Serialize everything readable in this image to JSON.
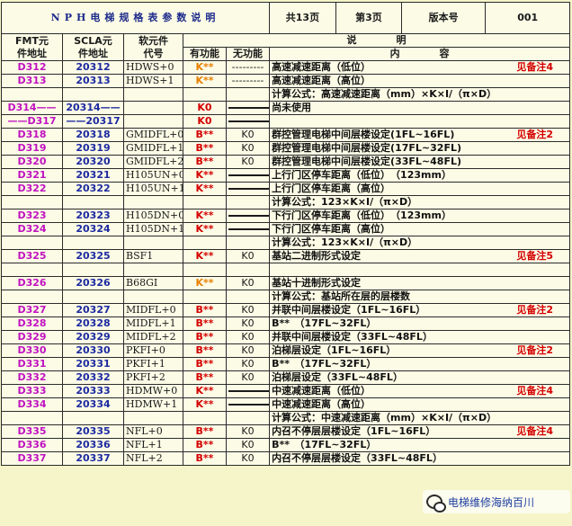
{
  "title": "NPH电梯规格表参数说明",
  "pager": {
    "total": "共13页",
    "page": "第3页",
    "version_label": "版本号",
    "version": "001"
  },
  "headers": {
    "fmt": [
      "FMT元",
      "件地址"
    ],
    "scla": [
      "SCLA元",
      "件地址"
    ],
    "code": [
      "软元件",
      "代号"
    ],
    "valid": "有功能",
    "invalid": "无功能",
    "explain": "说　　　　明",
    "content": "内　　　　容"
  },
  "rows": [
    {
      "fmt": "D312",
      "scla": "20312",
      "code": "HDWS+0",
      "valid": "K**",
      "valid_style": "orange",
      "invalid": "---------",
      "desc": "高速减速距离（低位）",
      "note": "见备注4"
    },
    {
      "fmt": "D313",
      "scla": "20313",
      "code": "HDWS+1",
      "valid": "K**",
      "valid_style": "orange",
      "invalid": "---------",
      "desc": "高速减速距离（高位）",
      "note": ""
    },
    {
      "fmt": "",
      "scla": "",
      "code": "",
      "valid": "",
      "valid_style": "",
      "invalid": "",
      "desc": "计算公式：高速减速距离（mm）×K×I/（π×D）",
      "note": ""
    },
    {
      "fmt": "D314——",
      "scla": "20314——",
      "code": "",
      "valid": "K0",
      "valid_style": "",
      "invalid": "line",
      "desc": "尚未使用",
      "note": ""
    },
    {
      "fmt": "——D317",
      "scla": "——20317",
      "code": "",
      "valid": "K0",
      "valid_style": "",
      "invalid": "line",
      "desc": "",
      "note": ""
    },
    {
      "fmt": "D318",
      "scla": "20318",
      "code": "GMIDFL+0",
      "valid": "B**",
      "valid_style": "",
      "invalid": "K0",
      "desc": "群控管理电梯中间层楼设定(1FL~16FL)",
      "note": "见备注2"
    },
    {
      "fmt": "D319",
      "scla": "20319",
      "code": "GMIDFL+1",
      "valid": "B**",
      "valid_style": "",
      "invalid": "K0",
      "desc": "群控管理电梯中间层楼设定(17FL~32FL)",
      "note": ""
    },
    {
      "fmt": "D320",
      "scla": "20320",
      "code": "GMIDFL+2",
      "valid": "B**",
      "valid_style": "",
      "invalid": "K0",
      "desc": "群控管理电梯中间层楼设定(33FL~48FL)",
      "note": ""
    },
    {
      "fmt": "D321",
      "scla": "20321",
      "code": "H105UN+0",
      "valid": "K**",
      "valid_style": "",
      "invalid": "line",
      "desc": "上行门区停车距离（低位）　（123mm）",
      "note": ""
    },
    {
      "fmt": "D322",
      "scla": "20322",
      "code": "H105UN+1",
      "valid": "K**",
      "valid_style": "",
      "invalid": "line",
      "desc": "上行门区停车距离（高位）",
      "note": ""
    },
    {
      "fmt": "",
      "scla": "",
      "code": "",
      "valid": "",
      "valid_style": "",
      "invalid": "",
      "desc": "计算公式：123×K×I/（π×D）",
      "note": ""
    },
    {
      "fmt": "D323",
      "scla": "20323",
      "code": "H105DN+0",
      "valid": "K**",
      "valid_style": "",
      "invalid": "line",
      "desc": "下行门区停车距离（低位）　（123mm）",
      "note": ""
    },
    {
      "fmt": "D324",
      "scla": "20324",
      "code": "H105DN+1",
      "valid": "K**",
      "valid_style": "",
      "invalid": "line",
      "desc": "下行门区停车距离（高位）",
      "note": ""
    },
    {
      "fmt": "",
      "scla": "",
      "code": "",
      "valid": "",
      "valid_style": "",
      "invalid": "",
      "desc": "计算公式：123×K×I/（π×D）",
      "note": ""
    },
    {
      "fmt": "D325",
      "scla": "20325",
      "code": "BSF1",
      "valid": "K**",
      "valid_style": "",
      "invalid": "K0",
      "desc": "基站二进制形式设定",
      "note": "见备注5"
    },
    {
      "fmt": "",
      "scla": "",
      "code": "",
      "valid": "",
      "valid_style": "",
      "invalid": "",
      "desc": "",
      "note": ""
    },
    {
      "fmt": "D326",
      "scla": "20326",
      "code": "B68GI",
      "valid": "K**",
      "valid_style": "orange",
      "invalid": "K0",
      "desc": "基站十进制形式设定",
      "note": ""
    },
    {
      "fmt": "",
      "scla": "",
      "code": "",
      "valid": "",
      "valid_style": "",
      "invalid": "",
      "desc": "计算公式：基站所在层的层楼数",
      "note": ""
    },
    {
      "fmt": "D327",
      "scla": "20327",
      "code": "MIDFL+0",
      "valid": "B**",
      "valid_style": "",
      "invalid": "K0",
      "desc": "并联中间层楼设定（1FL~16FL）",
      "note": "见备注2"
    },
    {
      "fmt": "D328",
      "scla": "20328",
      "code": "MIDFL+1",
      "valid": "B**",
      "valid_style": "",
      "invalid": "K0",
      "desc": "B**　（17FL~32FL）",
      "note": ""
    },
    {
      "fmt": "D329",
      "scla": "20329",
      "code": "MIDFL+2",
      "valid": "B**",
      "valid_style": "",
      "invalid": "K0",
      "desc": "并联中间层楼设定（33FL~48FL）",
      "note": ""
    },
    {
      "fmt": "D330",
      "scla": "20330",
      "code": "PKFI+0",
      "valid": "B**",
      "valid_style": "",
      "invalid": "K0",
      "desc": "泊梯层设定（1FL~16FL）",
      "note": "见备注2"
    },
    {
      "fmt": "D331",
      "scla": "20331",
      "code": "PKFI+1",
      "valid": "B**",
      "valid_style": "",
      "invalid": "K0",
      "desc": "B**　（17FL~32FL）",
      "note": ""
    },
    {
      "fmt": "D332",
      "scla": "20332",
      "code": "PKFI+2",
      "valid": "B**",
      "valid_style": "",
      "invalid": "K0",
      "desc": "泊梯层设定（33FL~48FL）",
      "note": ""
    },
    {
      "fmt": "D333",
      "scla": "20333",
      "code": "HDMW+0",
      "valid": "K**",
      "valid_style": "",
      "invalid": "line",
      "desc": "中速减速距离（低位）",
      "note": "见备注4"
    },
    {
      "fmt": "D334",
      "scla": "20334",
      "code": "HDMW+1",
      "valid": "K**",
      "valid_style": "",
      "invalid": "line",
      "desc": "中速减速距离（高位）",
      "note": ""
    },
    {
      "fmt": "",
      "scla": "",
      "code": "",
      "valid": "",
      "valid_style": "",
      "invalid": "",
      "desc": "计算公式：中速减速距离（mm）×K×I/（π×D）",
      "note": ""
    },
    {
      "fmt": "D335",
      "scla": "20335",
      "code": "NFL+0",
      "valid": "B**",
      "valid_style": "",
      "invalid": "K0",
      "desc": "内召不停层层楼设定（1FL~16FL）",
      "note": "见备注4"
    },
    {
      "fmt": "D336",
      "scla": "20336",
      "code": "NFL+1",
      "valid": "B**",
      "valid_style": "",
      "invalid": "K0",
      "desc": "B**　（17FL~32FL）",
      "note": ""
    },
    {
      "fmt": "D337",
      "scla": "20337",
      "code": "NFL+2",
      "valid": "B**",
      "valid_style": "",
      "invalid": "K0",
      "desc": "内召不停层层楼设定（33FL~48FL）",
      "note": ""
    }
  ],
  "watermark": {
    "text": "电梯维修海纳百川",
    "icon": "wechat-icon"
  }
}
